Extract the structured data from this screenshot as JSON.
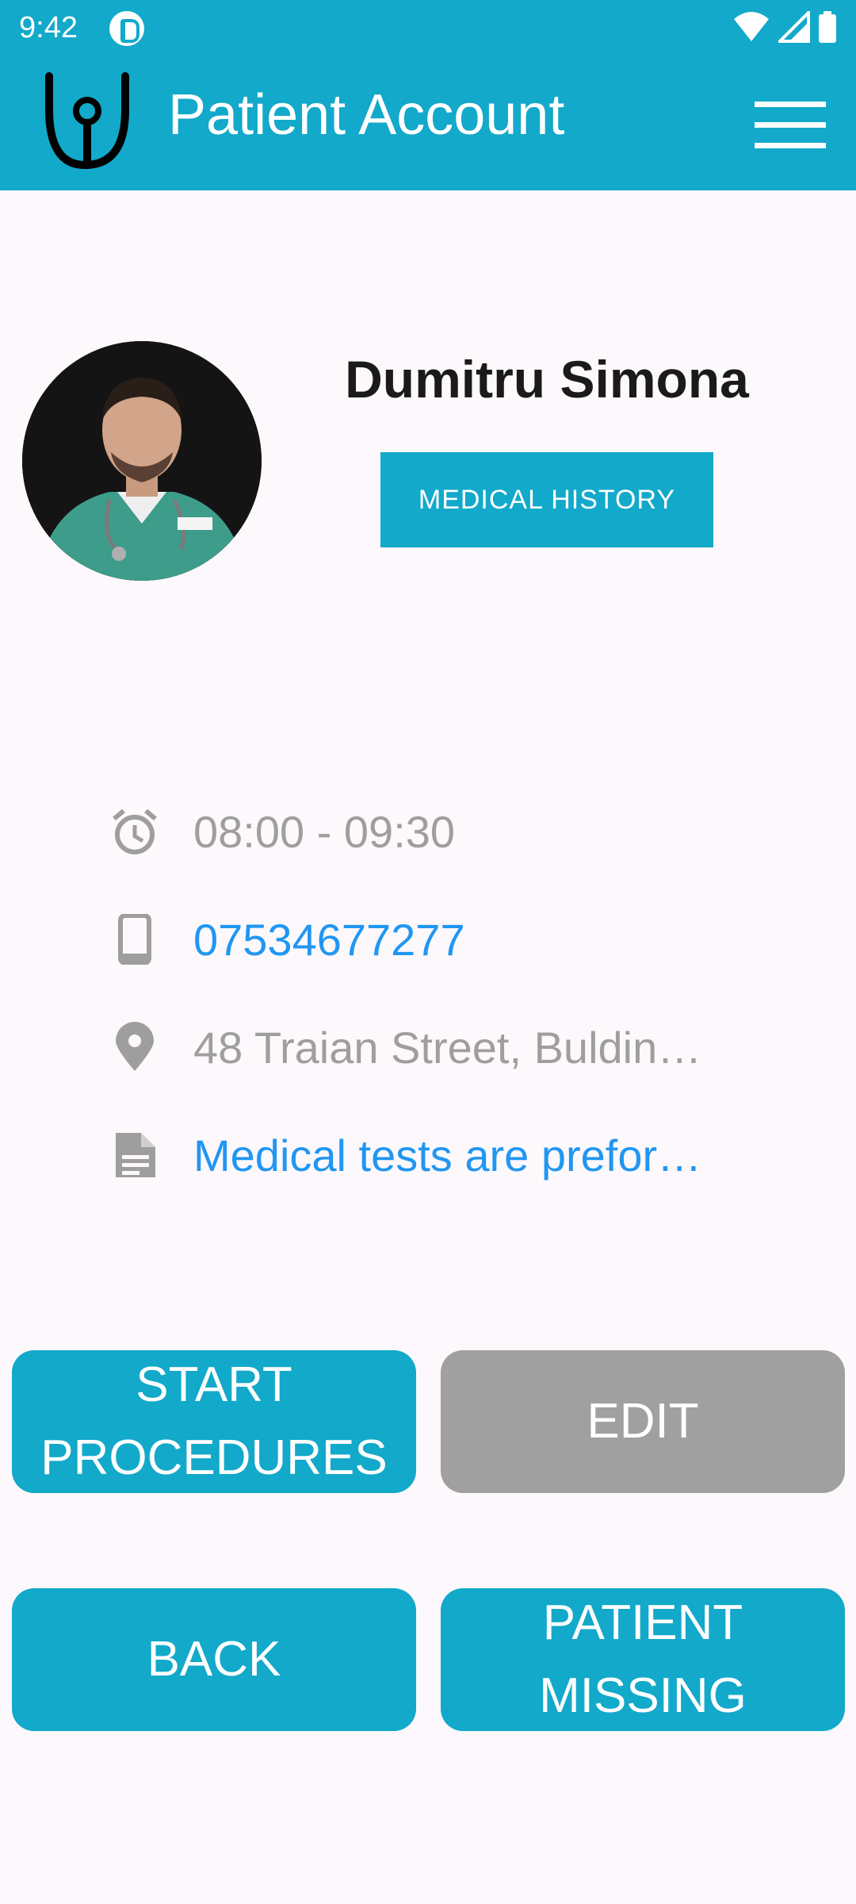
{
  "status_bar": {
    "time": "9:42"
  },
  "header": {
    "title": "Patient Account"
  },
  "patient": {
    "name": "Dumitru Simona"
  },
  "actions": {
    "medical_history": "MEDICAL HISTORY"
  },
  "details": [
    {
      "icon": "alarm-clock-icon",
      "text": "08:00 - 09:30",
      "style": "gray"
    },
    {
      "icon": "phone-icon",
      "text": "07534677277",
      "style": "blue"
    },
    {
      "icon": "location-pin-icon",
      "text": "48 Traian Street, Buldin…",
      "style": "gray"
    },
    {
      "icon": "document-icon",
      "text": "Medical tests are prefor…",
      "style": "blue"
    }
  ],
  "buttons": {
    "start_procedures": "START PROCEDURES",
    "edit": "EDIT",
    "back": "BACK",
    "patient_missing": "PATIENT MISSING"
  },
  "colors": {
    "accent": "#12A9CA",
    "disabled": "#A0A0A0",
    "link": "#2196F3",
    "muted_text": "#9E9E9E"
  }
}
